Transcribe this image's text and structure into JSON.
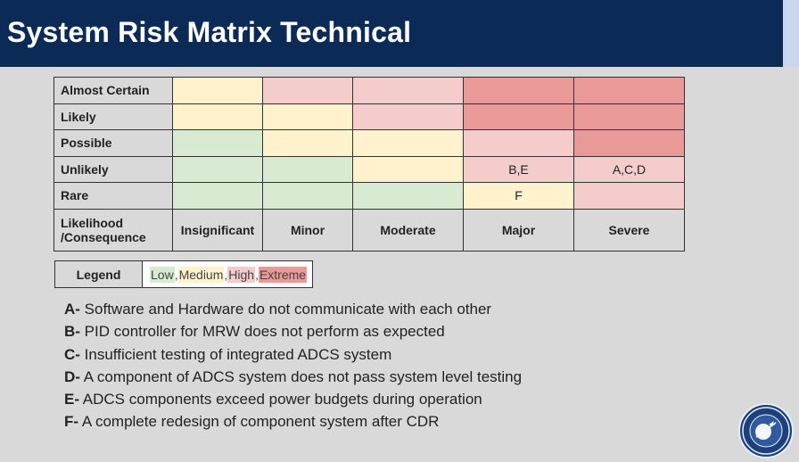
{
  "header": {
    "title": "System Risk Matrix Technical"
  },
  "matrix": {
    "rows": [
      {
        "label": "Almost Certain",
        "cells": [
          {
            "level": "med",
            "text": ""
          },
          {
            "level": "high",
            "text": ""
          },
          {
            "level": "high",
            "text": ""
          },
          {
            "level": "ext",
            "text": ""
          },
          {
            "level": "ext",
            "text": ""
          }
        ]
      },
      {
        "label": "Likely",
        "cells": [
          {
            "level": "med",
            "text": ""
          },
          {
            "level": "med",
            "text": ""
          },
          {
            "level": "high",
            "text": ""
          },
          {
            "level": "ext",
            "text": ""
          },
          {
            "level": "ext",
            "text": ""
          }
        ]
      },
      {
        "label": "Possible",
        "cells": [
          {
            "level": "low",
            "text": ""
          },
          {
            "level": "med",
            "text": ""
          },
          {
            "level": "med",
            "text": ""
          },
          {
            "level": "high",
            "text": ""
          },
          {
            "level": "ext",
            "text": ""
          }
        ]
      },
      {
        "label": "Unlikely",
        "cells": [
          {
            "level": "low",
            "text": ""
          },
          {
            "level": "low",
            "text": ""
          },
          {
            "level": "med",
            "text": ""
          },
          {
            "level": "high",
            "text": "B,E"
          },
          {
            "level": "high",
            "text": "A,C,D"
          }
        ]
      },
      {
        "label": "Rare",
        "cells": [
          {
            "level": "low",
            "text": ""
          },
          {
            "level": "low",
            "text": ""
          },
          {
            "level": "low",
            "text": ""
          },
          {
            "level": "med",
            "text": "F"
          },
          {
            "level": "high",
            "text": ""
          }
        ]
      }
    ],
    "corner_line1": "Likelihood",
    "corner_line2": "/Consequence",
    "columns": [
      "Insignificant",
      "Minor",
      "Moderate",
      "Major",
      "Severe"
    ]
  },
  "legend": {
    "label": "Legend",
    "low": "Low",
    "medium": "Medium",
    "high": "High",
    "extreme": "Extreme",
    "sep": ", "
  },
  "risks": [
    {
      "key": "A-",
      "text": " Software and Hardware do not communicate with each other"
    },
    {
      "key": "B-",
      "text": " PID controller for MRW does not perform as expected"
    },
    {
      "key": "C-",
      "text": " Insufficient testing of integrated ADCS system"
    },
    {
      "key": "D-",
      "text": " A component of ADCS system does not pass system level testing"
    },
    {
      "key": "E-",
      "text": " ADCS components exceed power budgets during operation"
    },
    {
      "key": "F-",
      "text": " A complete redesign of component system after CDR"
    }
  ],
  "colors": {
    "low": "#d9ead3",
    "medium": "#fff2cc",
    "high": "#f4cccc",
    "extreme": "#ea9999",
    "header": "#0b2a55"
  },
  "icons": {
    "seal": "university-seal-icon"
  }
}
